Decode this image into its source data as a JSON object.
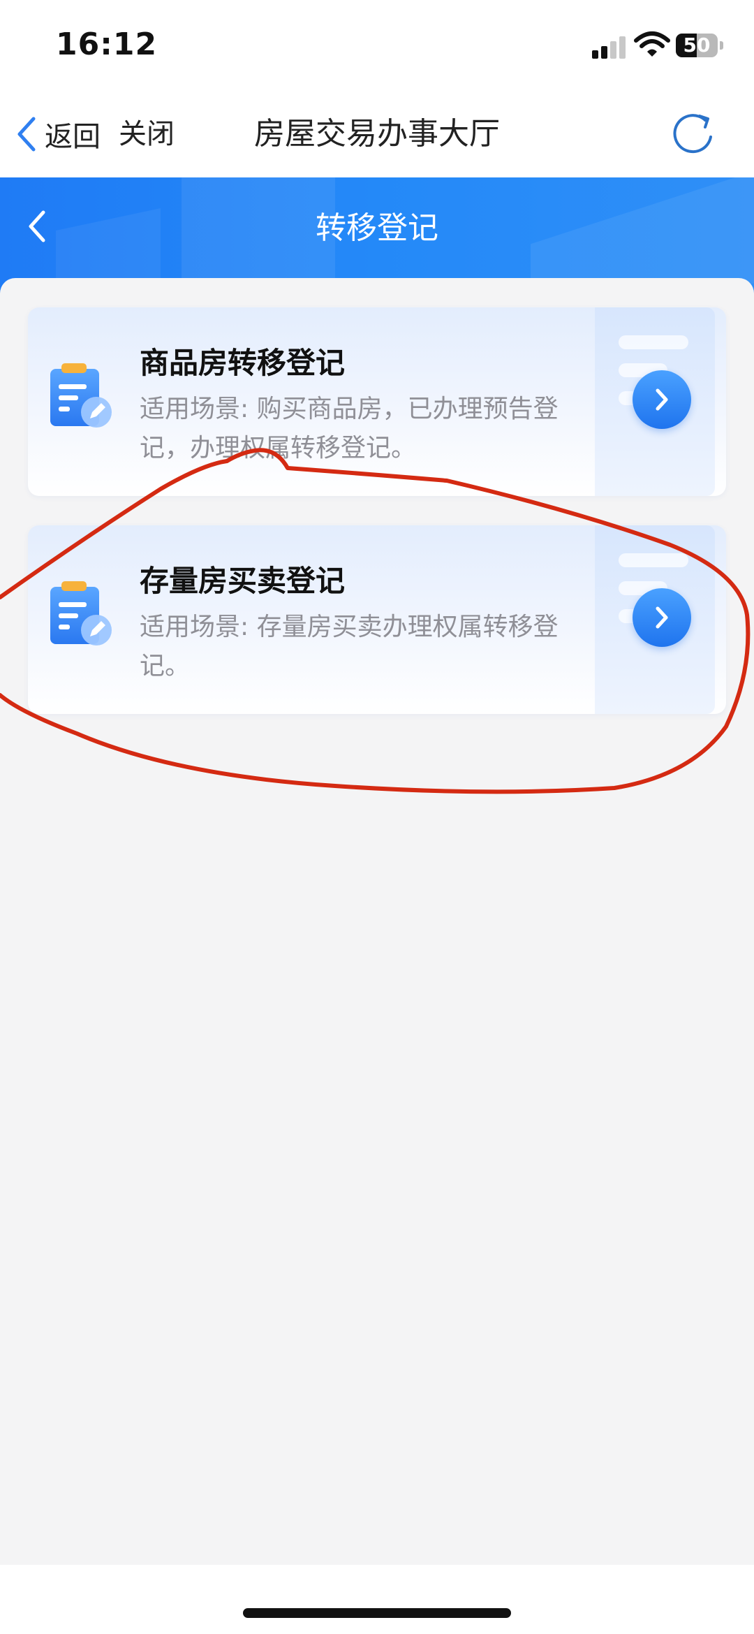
{
  "status_bar": {
    "time": "16:12",
    "battery_percent": 50,
    "battery_label": "50"
  },
  "nav": {
    "back_label": "返回",
    "close_label": "关闭",
    "title": "房屋交易办事大厅"
  },
  "banner": {
    "title": "转移登记"
  },
  "cards": [
    {
      "title": "商品房转移登记",
      "desc": "适用场景: 购买商品房，已办理预告登记，办理权属转移登记。"
    },
    {
      "title": "存量房买卖登记",
      "desc": "适用场景: 存量房买卖办理权属转移登记。"
    }
  ],
  "colors": {
    "primary_blue": "#1f7bf5",
    "annotation_red": "#d42a12"
  },
  "icons": [
    "chevron-left-icon",
    "refresh-icon",
    "clipboard-edit-icon",
    "chevron-right-icon",
    "signal-icon",
    "wifi-icon",
    "battery-icon"
  ]
}
